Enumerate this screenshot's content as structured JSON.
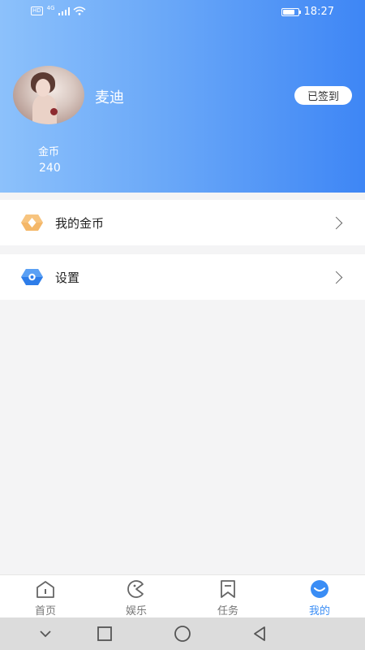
{
  "status_bar": {
    "network_badge": "HD",
    "network_type": "4G",
    "time": "18:27"
  },
  "profile": {
    "username": "麦迪",
    "signed_in_label": "已签到",
    "coins_label": "金币",
    "coins_value": "240"
  },
  "menu": [
    {
      "label": "我的金币",
      "icon": "coin-icon",
      "color": "#f0a24a"
    },
    {
      "label": "设置",
      "icon": "settings-hex-icon",
      "color": "#3b86f0"
    }
  ],
  "tabs": [
    {
      "label": "首页",
      "icon": "home-icon"
    },
    {
      "label": "娱乐",
      "icon": "game-icon"
    },
    {
      "label": "任务",
      "icon": "bookmark-icon"
    },
    {
      "label": "我的",
      "icon": "profile-icon",
      "active": true
    }
  ],
  "colors": {
    "accent": "#3a8df5",
    "header_start": "#8cc1fb",
    "header_end": "#3e86f5"
  }
}
